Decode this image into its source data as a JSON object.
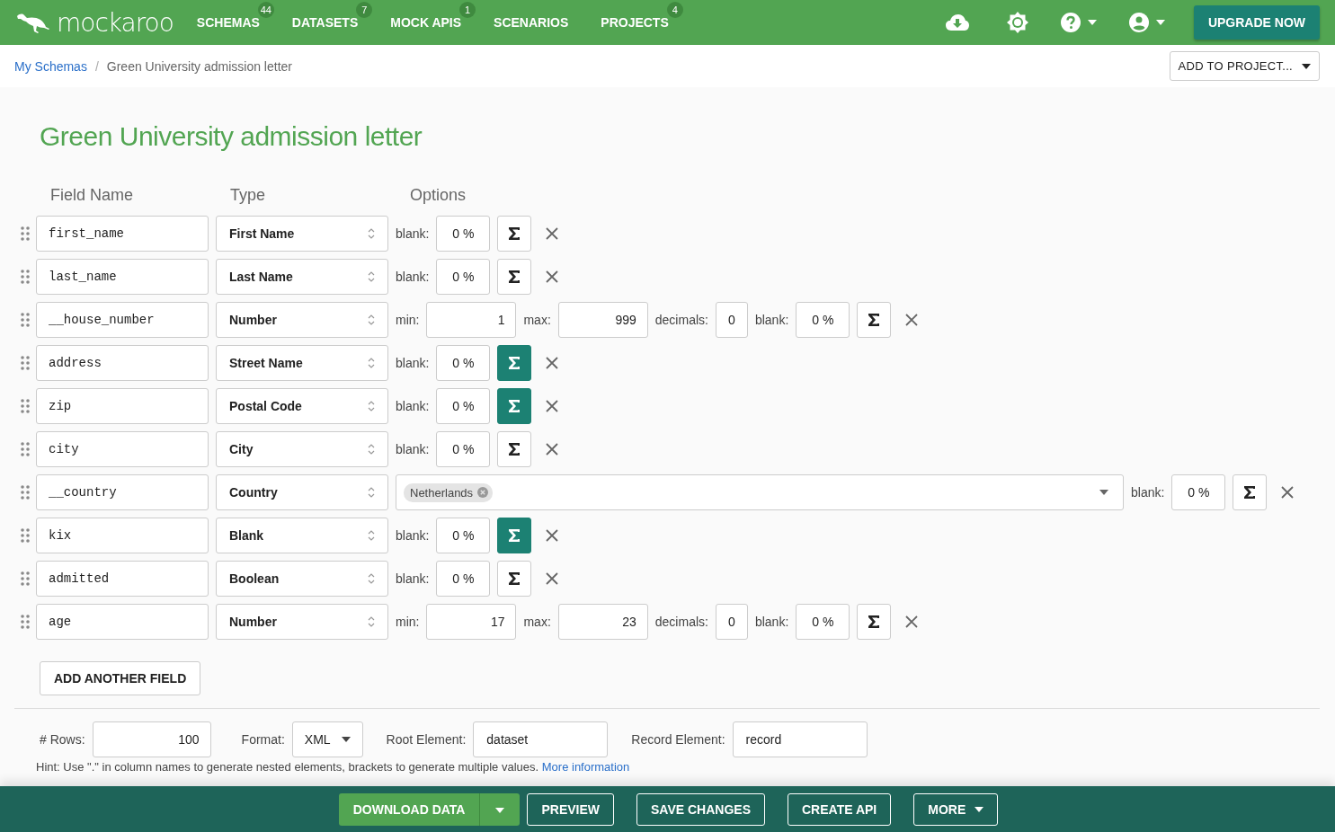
{
  "nav": {
    "logo": "mockaroo",
    "items": [
      {
        "label": "SCHEMAS",
        "badge": "44"
      },
      {
        "label": "DATASETS",
        "badge": "7"
      },
      {
        "label": "MOCK APIS",
        "badge": "1"
      },
      {
        "label": "SCENARIOS"
      },
      {
        "label": "PROJECTS",
        "badge": "4"
      }
    ],
    "upgrade": "UPGRADE NOW"
  },
  "breadcrumb": {
    "link": "My Schemas",
    "separator": "/",
    "current": "Green University admission letter",
    "add_to_project": "ADD TO PROJECT..."
  },
  "title": "Green University admission letter",
  "columns": [
    "Field Name",
    "Type",
    "Options"
  ],
  "fields": [
    {
      "kind": "blank",
      "name": "first_name",
      "type": "First Name",
      "blank_label": "blank:",
      "blank": "0 %",
      "formula_active": false
    },
    {
      "kind": "blank",
      "name": "last_name",
      "type": "Last Name",
      "blank_label": "blank:",
      "blank": "0 %",
      "formula_active": false
    },
    {
      "kind": "number",
      "name": "__house_number",
      "type": "Number",
      "min_label": "min:",
      "min": "1",
      "max_label": "max:",
      "max": "999",
      "decimals_label": "decimals:",
      "decimals": "0",
      "blank_label": "blank:",
      "blank": "0 %",
      "formula_active": false
    },
    {
      "kind": "blank",
      "name": "address",
      "type": "Street Name",
      "blank_label": "blank:",
      "blank": "0 %",
      "formula_active": true
    },
    {
      "kind": "blank",
      "name": "zip",
      "type": "Postal Code",
      "blank_label": "blank:",
      "blank": "0 %",
      "formula_active": true
    },
    {
      "kind": "blank",
      "name": "city",
      "type": "City",
      "blank_label": "blank:",
      "blank": "0 %",
      "formula_active": false
    },
    {
      "kind": "country",
      "name": "__country",
      "type": "Country",
      "tags": [
        "Netherlands"
      ],
      "blank_label": "blank:",
      "blank": "0 %",
      "formula_active": false
    },
    {
      "kind": "blank",
      "name": "kix",
      "type": "Blank",
      "blank_label": "blank:",
      "blank": "0 %",
      "formula_active": true
    },
    {
      "kind": "blank",
      "name": "admitted",
      "type": "Boolean",
      "blank_label": "blank:",
      "blank": "0 %",
      "formula_active": false
    },
    {
      "kind": "number",
      "name": "age",
      "type": "Number",
      "min_label": "min:",
      "min": "17",
      "max_label": "max:",
      "max": "23",
      "decimals_label": "decimals:",
      "decimals": "0",
      "blank_label": "blank:",
      "blank": "0 %",
      "formula_active": false
    }
  ],
  "add_field": "ADD ANOTHER FIELD",
  "settings": {
    "rows_label": "# Rows:",
    "rows": "100",
    "format_label": "Format:",
    "format": "XML",
    "root_label": "Root Element:",
    "root": "dataset",
    "record_label": "Record Element:",
    "record": "record"
  },
  "hint": {
    "text": "Hint: Use \".\" in column names to generate nested elements, brackets to generate multiple values.",
    "link": "More information"
  },
  "actions": {
    "download": "DOWNLOAD DATA",
    "preview": "PREVIEW",
    "save": "SAVE CHANGES",
    "create_api": "CREATE API",
    "more": "MORE"
  }
}
